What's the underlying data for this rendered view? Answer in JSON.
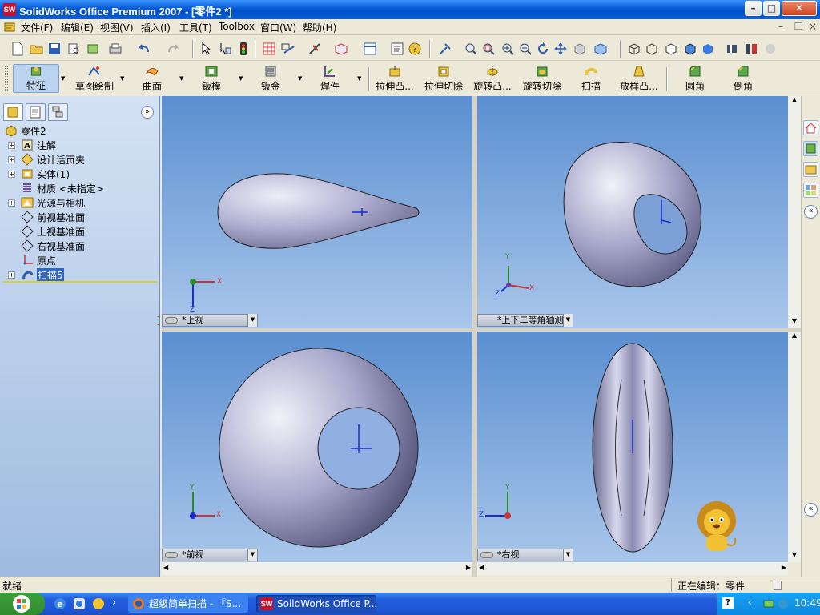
{
  "window": {
    "title": "SolidWorks Office Premium 2007 - [零件2 *]",
    "logo_text": "SW",
    "controls": {
      "minimize": "–",
      "restore": "□",
      "close": "✕"
    }
  },
  "menubar": {
    "items": [
      "文件(F)",
      "编辑(E)",
      "视图(V)",
      "插入(I)",
      "工具(T)",
      "Toolbox",
      "窗口(W)",
      "帮助(H)"
    ],
    "doc_controls": {
      "minimize": "–",
      "restore": "❐",
      "close": "×"
    }
  },
  "command_manager": {
    "tabs": [
      "特征",
      "草图绘制",
      "曲面",
      "钣模",
      "钣金",
      "焊件"
    ],
    "selected_tab": "特征",
    "commands": [
      "拉伸凸...",
      "拉伸切除",
      "旋转凸...",
      "旋转切除",
      "扫描",
      "放样凸...",
      "圆角",
      "倒角"
    ]
  },
  "feature_tree": {
    "root": "零件2",
    "items": [
      {
        "label": "注解",
        "icon": "annotation-icon",
        "expandable": true
      },
      {
        "label": "设计活页夹",
        "icon": "design-binder-icon",
        "expandable": true
      },
      {
        "label": "实体(1)",
        "icon": "solid-bodies-icon",
        "expandable": true
      },
      {
        "label": "材质 <未指定>",
        "icon": "material-icon",
        "expandable": false
      },
      {
        "label": "光源与相机",
        "icon": "lights-cameras-icon",
        "expandable": true
      },
      {
        "label": "前视基准面",
        "icon": "plane-icon",
        "expandable": false
      },
      {
        "label": "上视基准面",
        "icon": "plane-icon",
        "expandable": false
      },
      {
        "label": "右视基准面",
        "icon": "plane-icon",
        "expandable": false
      },
      {
        "label": "原点",
        "icon": "origin-icon",
        "expandable": false
      },
      {
        "label": "扫描5",
        "icon": "sweep-icon",
        "expandable": true,
        "selected": true
      }
    ]
  },
  "viewports": [
    {
      "name": "top",
      "label": "*上视"
    },
    {
      "name": "dimetric",
      "label": "*上下二等角轴测"
    },
    {
      "name": "front",
      "label": "*前视"
    },
    {
      "name": "right",
      "label": "*右视"
    }
  ],
  "axes": {
    "x": "X",
    "y": "Y",
    "z": "Z"
  },
  "statusbar": {
    "left": "就绪",
    "right": "正在编辑：零件"
  },
  "taskbar": {
    "tasks": [
      "超级简单扫描 - 『S...",
      "SolidWorks Office P..."
    ],
    "clock": "10:49"
  },
  "colors": {
    "accent": "#0a5fd8",
    "viewport_top": "#5b8fd1",
    "viewport_bottom": "#a9c6ea",
    "model": "#a8a8cc"
  }
}
